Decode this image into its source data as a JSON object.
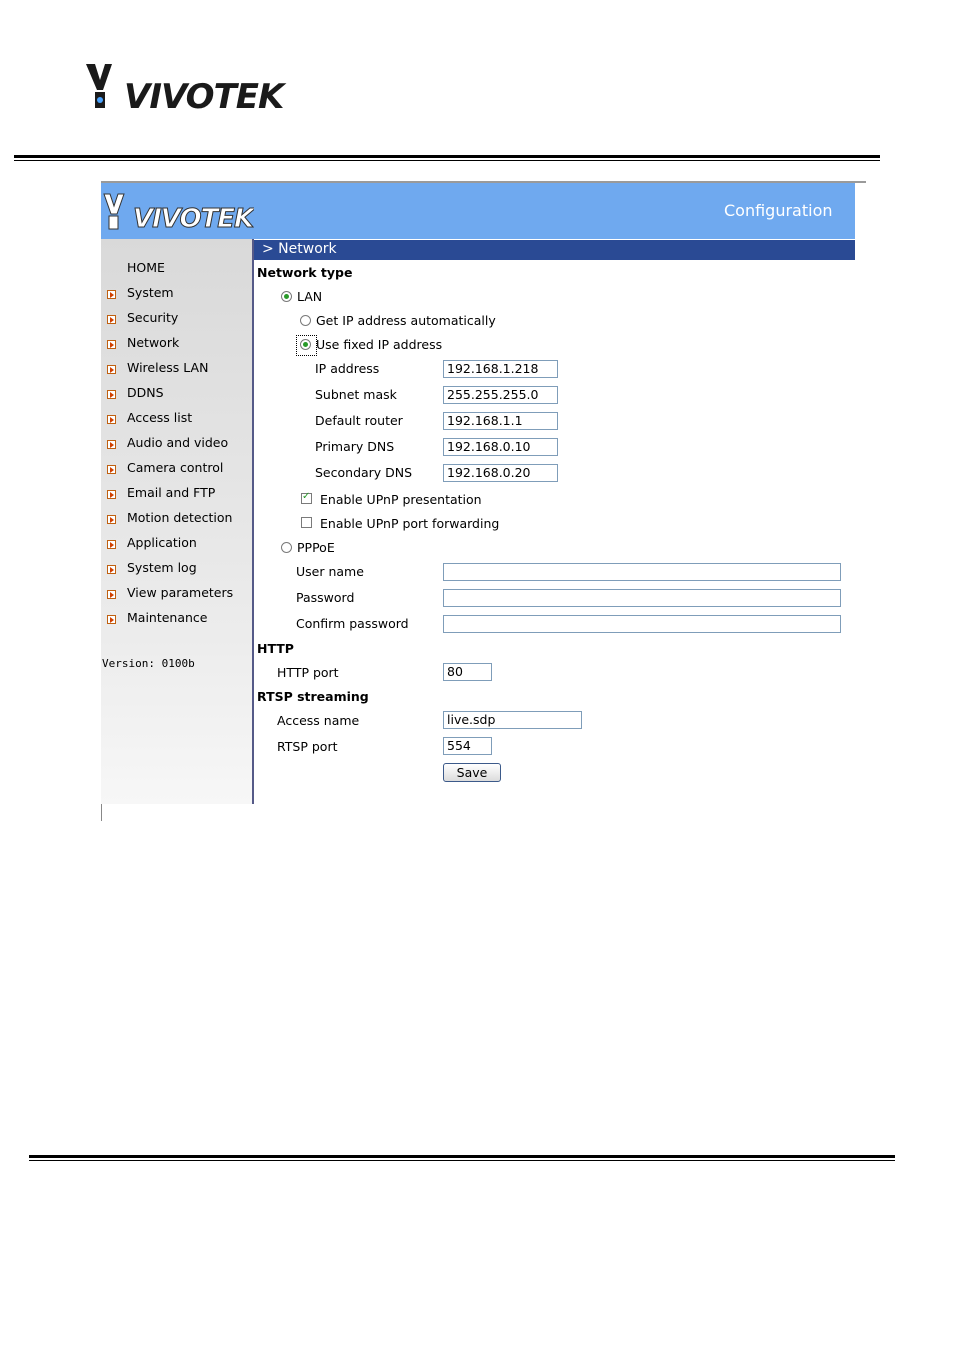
{
  "brand": {
    "name": "VIVOTEK"
  },
  "header": {
    "title": "Configuration"
  },
  "breadcrumb": "> Network",
  "sidebar": {
    "items": [
      {
        "label": "HOME",
        "arrow": false
      },
      {
        "label": "System",
        "arrow": true
      },
      {
        "label": "Security",
        "arrow": true
      },
      {
        "label": "Network",
        "arrow": true
      },
      {
        "label": "Wireless LAN",
        "arrow": true
      },
      {
        "label": "DDNS",
        "arrow": true
      },
      {
        "label": "Access list",
        "arrow": true
      },
      {
        "label": "Audio and video",
        "arrow": true
      },
      {
        "label": "Camera control",
        "arrow": true
      },
      {
        "label": "Email and FTP",
        "arrow": true
      },
      {
        "label": "Motion detection",
        "arrow": true
      },
      {
        "label": "Application",
        "arrow": true
      },
      {
        "label": "System log",
        "arrow": true
      },
      {
        "label": "View parameters",
        "arrow": true
      },
      {
        "label": "Maintenance",
        "arrow": true
      }
    ],
    "version": "Version: 0100b"
  },
  "network_type": {
    "heading": "Network type",
    "lan": {
      "label": "LAN",
      "selected": true
    },
    "auto_ip": {
      "label": "Get IP address automatically",
      "selected": false
    },
    "fixed_ip": {
      "label": "Use fixed IP address",
      "selected": true
    },
    "fields": {
      "ip_address": {
        "label": "IP address",
        "value": "192.168.1.218"
      },
      "subnet_mask": {
        "label": "Subnet mask",
        "value": "255.255.255.0"
      },
      "default_router": {
        "label": "Default router",
        "value": "192.168.1.1"
      },
      "primary_dns": {
        "label": "Primary DNS",
        "value": "192.168.0.10"
      },
      "secondary_dns": {
        "label": "Secondary DNS",
        "value": "192.168.0.20"
      }
    },
    "upnp_presentation": {
      "label": "Enable UPnP presentation",
      "checked": true
    },
    "upnp_forwarding": {
      "label": "Enable UPnP port forwarding",
      "checked": false
    },
    "pppoe": {
      "label": "PPPoE",
      "selected": false
    },
    "pppoe_fields": {
      "user_name": {
        "label": "User name",
        "value": ""
      },
      "password": {
        "label": "Password",
        "value": ""
      },
      "confirm_password": {
        "label": "Confirm password",
        "value": ""
      }
    }
  },
  "http": {
    "heading": "HTTP",
    "port": {
      "label": "HTTP port",
      "value": "80"
    }
  },
  "rtsp": {
    "heading": "RTSP streaming",
    "access_name": {
      "label": "Access name",
      "value": "live.sdp"
    },
    "port": {
      "label": "RTSP port",
      "value": "554"
    }
  },
  "actions": {
    "save_label": "Save"
  },
  "colors": {
    "header_bg": "#6fa9ef",
    "subheader_bg": "#2a4a94",
    "radio_on": "#2a9a2a",
    "arrow": "#d04000"
  }
}
